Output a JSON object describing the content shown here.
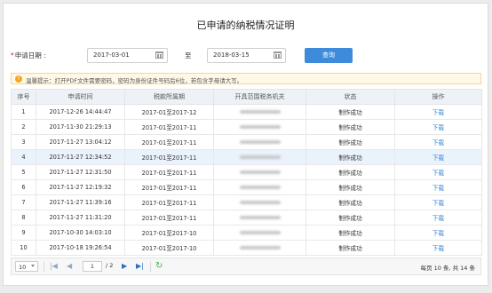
{
  "page": {
    "title": "已申请的纳税情况证明"
  },
  "form": {
    "required_mark": "*",
    "date_label": "申请日期 :",
    "start_date": "2017-03-01",
    "to_label": "至",
    "end_date": "2018-03-15",
    "query_button": "查询"
  },
  "tip": {
    "icon": "info-icon",
    "icon_glyph": "!",
    "text": "温馨提示：打开PDF文件需要密码，密码为身份证件号码后6位，若包含字母请大写。"
  },
  "table": {
    "columns": [
      "序号",
      "申请时间",
      "税款所属期",
      "开具范围税务机关",
      "状态",
      "操作"
    ],
    "rows": [
      {
        "no": "1",
        "time": "2017-12-26 14:44:47",
        "period": "2017-01至2017-12",
        "status": "制作成功",
        "action": "下载"
      },
      {
        "no": "2",
        "time": "2017-11-30 21:29:13",
        "period": "2017-01至2017-11",
        "status": "制作成功",
        "action": "下载"
      },
      {
        "no": "3",
        "time": "2017-11-27 13:04:12",
        "period": "2017-01至2017-11",
        "status": "制作成功",
        "action": "下载"
      },
      {
        "no": "4",
        "time": "2017-11-27 12:34:52",
        "period": "2017-01至2017-11",
        "status": "制作成功",
        "action": "下载"
      },
      {
        "no": "5",
        "time": "2017-11-27 12:31:50",
        "period": "2017-01至2017-11",
        "status": "制作成功",
        "action": "下载"
      },
      {
        "no": "6",
        "time": "2017-11-27 12:19:32",
        "period": "2017-01至2017-11",
        "status": "制作成功",
        "action": "下载"
      },
      {
        "no": "7",
        "time": "2017-11-27 11:39:16",
        "period": "2017-01至2017-11",
        "status": "制作成功",
        "action": "下载"
      },
      {
        "no": "8",
        "time": "2017-11-27 11:31:20",
        "period": "2017-01至2017-11",
        "status": "制作成功",
        "action": "下载"
      },
      {
        "no": "9",
        "time": "2017-10-30 14:03:10",
        "period": "2017-01至2017-10",
        "status": "制作成功",
        "action": "下载"
      },
      {
        "no": "10",
        "time": "2017-10-18 19:26:54",
        "period": "2017-01至2017-10",
        "status": "制作成功",
        "action": "下载"
      }
    ],
    "selected_row": "4"
  },
  "pager": {
    "page_size": "10",
    "current_page": "1",
    "total_pages": "/ 2",
    "summary": "每页 10 条, 共 14 条",
    "icons": [
      "first-page-icon",
      "prev-page-icon",
      "next-page-icon",
      "last-page-icon",
      "refresh-icon"
    ]
  },
  "colors": {
    "accent": "#3e8bdc",
    "link": "#2b7fd6",
    "tip_bg": "#fff8e6",
    "tip_icon": "#f5a623",
    "header_bg": "#eef2f7",
    "selected_row_bg": "#eaf2fc",
    "required": "#e02020"
  }
}
